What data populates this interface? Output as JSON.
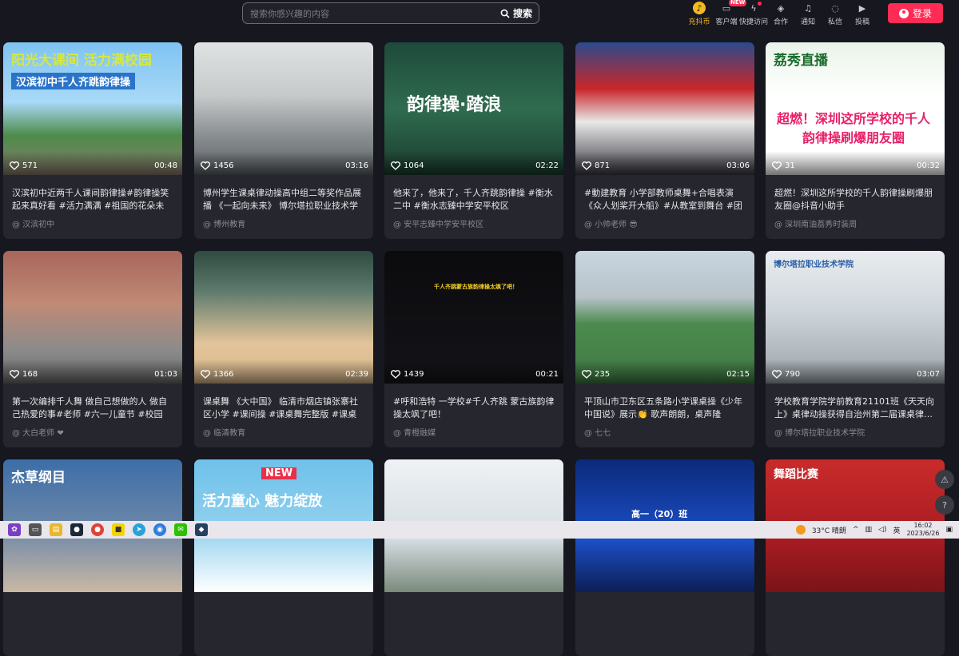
{
  "search": {
    "placeholder": "搜索你感兴趣的内容",
    "button": "搜索"
  },
  "toolbar": [
    {
      "name": "charge-coin",
      "label": "充抖币",
      "icon": "coin-icon",
      "extra": ""
    },
    {
      "name": "client",
      "label": "客户端",
      "icon": "monitor-icon",
      "extra": "NEW"
    },
    {
      "name": "quick-access",
      "label": "快捷访问",
      "icon": "bolt-icon",
      "extra": "dot"
    },
    {
      "name": "cooperate",
      "label": "合作",
      "icon": "cube-icon",
      "extra": ""
    },
    {
      "name": "notify",
      "label": "通知",
      "icon": "bell-icon",
      "extra": ""
    },
    {
      "name": "message",
      "label": "私信",
      "icon": "chat-icon",
      "extra": ""
    },
    {
      "name": "upload",
      "label": "投稿",
      "icon": "camera-icon",
      "extra": ""
    }
  ],
  "login": {
    "label": "登录"
  },
  "cards": [
    {
      "likes": "571",
      "duration": "00:48",
      "caption": "汉滨初中近两千人课间韵律操#韵律操笑起来真好看 #活力满满 #祖国的花朵未来…",
      "author": "@ 汉滨初中",
      "bg": "linear-gradient(#7ec3f2 0%,#a9d9f7 45%,#4d8c4a 70%,#8a7b6c 100%)",
      "t1": "阳光大课间  活力满校园",
      "t2": "汉滨初中千人齐跳韵律操"
    },
    {
      "likes": "1456",
      "duration": "03:16",
      "caption": "博州学生课桌律动操高中组二等奖作品展播 《一起向未来》 博尔塔拉职业技术学院",
      "author": "@ 博州教育",
      "bg": "linear-gradient(#dfe2e3 0%,#c7cacb 40%,#8a8f92 70%,#5d6266 100%)",
      "t1": "",
      "t2": ""
    },
    {
      "likes": "1064",
      "duration": "02:22",
      "caption": "他来了，他来了，千人齐跳韵律操 #衡水二中 #衡水志臻中学安平校区",
      "author": "@ 安平志臻中学安平校区",
      "bg": "linear-gradient(#1e4a3a 0%,#2f6b4f 50%,#1a3d2f 100%)",
      "t1": "韵律操·踏浪",
      "t2": ""
    },
    {
      "likes": "871",
      "duration": "03:06",
      "caption": "#動建教育 小学部教师桌舞+合唱表演《众人划桨开大船》#从教室到舞台 #团队精…",
      "author": "@ 小帅老师 😎",
      "bg": "linear-gradient(#2a4b8c 0%,#c9262a 35%,#e8e8e8 60%,#3b3b44 100%)",
      "t1": "",
      "t2": ""
    },
    {
      "likes": "31",
      "duration": "00:32",
      "caption": "超燃！深圳这所学校的千人韵律操刷爆朋友圈@抖音小助手",
      "author": "@ 深圳南油荔秀时装周",
      "bg": "linear-gradient(#e9f4e9 0%,#ffffff 40%,#ffffff 100%)",
      "t1": "荔秀直播",
      "t2": "超燃！深圳这所学校的千人韵律操刷爆朋友圈"
    },
    {
      "likes": "168",
      "duration": "01:03",
      "caption": "第一次编排千人舞 做自己想做的人 做自己热爱的事#老师 #六一儿童节 #校园",
      "author": "@ 大白老师 ❤",
      "bg": "linear-gradient(#a8665a 0%,#c08a76 40%,#8b8b8b 75%,#6a6a6a 100%)",
      "t1": "",
      "t2": ""
    },
    {
      "likes": "1366",
      "duration": "02:39",
      "caption": "课桌舞 《大中国》 临清市烟店镇张寨社区小学 #课间操 #课桌舞完整版 #课桌舞…",
      "author": "@ 临清教育",
      "bg": "linear-gradient(#2f4a3f 0%,#5d7a6d 30%,#e3c49a 70%,#d9b88c 100%)",
      "t1": "",
      "t2": ""
    },
    {
      "likes": "1439",
      "duration": "00:21",
      "caption": "#呼和浩特 一学校#千人齐跳 蒙古族韵律操太飒了吧！",
      "author": "@ 青橙融媒",
      "bg": "linear-gradient(#0b0b0e 0%,#141418 100%)",
      "t1": "千人齐跳蒙古族韵律操太飒了吧！",
      "t2": ""
    },
    {
      "likes": "235",
      "duration": "02:15",
      "caption": "平顶山市卫东区五条路小学课桌操《少年中国说》展示👏 歌声朗朗，桌声隆隆。…",
      "author": "@ 七七",
      "bg": "linear-gradient(#c9d6e0 0%,#b7c2c9 35%,#4c8a4f 55%,#3f7a43 100%)",
      "t1": "",
      "t2": ""
    },
    {
      "likes": "790",
      "duration": "03:07",
      "caption": "学校教育学院学前教育21101班《天天向上》桌律动操获得自治州第二届课桌律…",
      "author": "@ 博尔塔拉职业技术学院",
      "bg": "linear-gradient(#e8ecef 0%,#cfd6db 45%,#9aa3a8 100%)",
      "t1": "博尔塔拉职业技术学院",
      "t2": ""
    },
    {
      "likes": "",
      "duration": "",
      "caption": "",
      "author": "",
      "bg": "linear-gradient(#3c6ea8 0%,#6a86a8 50%,#c9b8a4 100%)",
      "t1": "杰草纲目",
      "t2": ""
    },
    {
      "likes": "",
      "duration": "",
      "caption": "",
      "author": "",
      "bg": "linear-gradient(#6fc1ea 0%,#8fd0ee 50%,#ffffff 100%)",
      "t1": "NEW",
      "t2": "活力童心 魅力绽放"
    },
    {
      "likes": "",
      "duration": "",
      "caption": "",
      "author": "",
      "bg": "linear-gradient(#eef2f5 0%,#d6dde2 60%,#7a8a7c 100%)",
      "t1": "",
      "t2": ""
    },
    {
      "likes": "",
      "duration": "",
      "caption": "",
      "author": "",
      "bg": "linear-gradient(#0b2a7a 0%,#1c4fc9 60%,#0d1f55 100%)",
      "t1": "高一（20）班",
      "t2": ""
    },
    {
      "likes": "",
      "duration": "",
      "caption": "",
      "author": "",
      "bg": "linear-gradient(#c92b2b 0%,#a81c22 60%,#7a1418 100%)",
      "t1": "舞蹈比赛",
      "t2": ""
    }
  ],
  "taskbar": {
    "weather": "33°C 晴朗",
    "time": "16:02",
    "date": "2023/6/26"
  },
  "colors": {
    "accent": "#fe2c55",
    "coin": "#f5b920",
    "bg": "#16171f",
    "card": "#25262e"
  }
}
